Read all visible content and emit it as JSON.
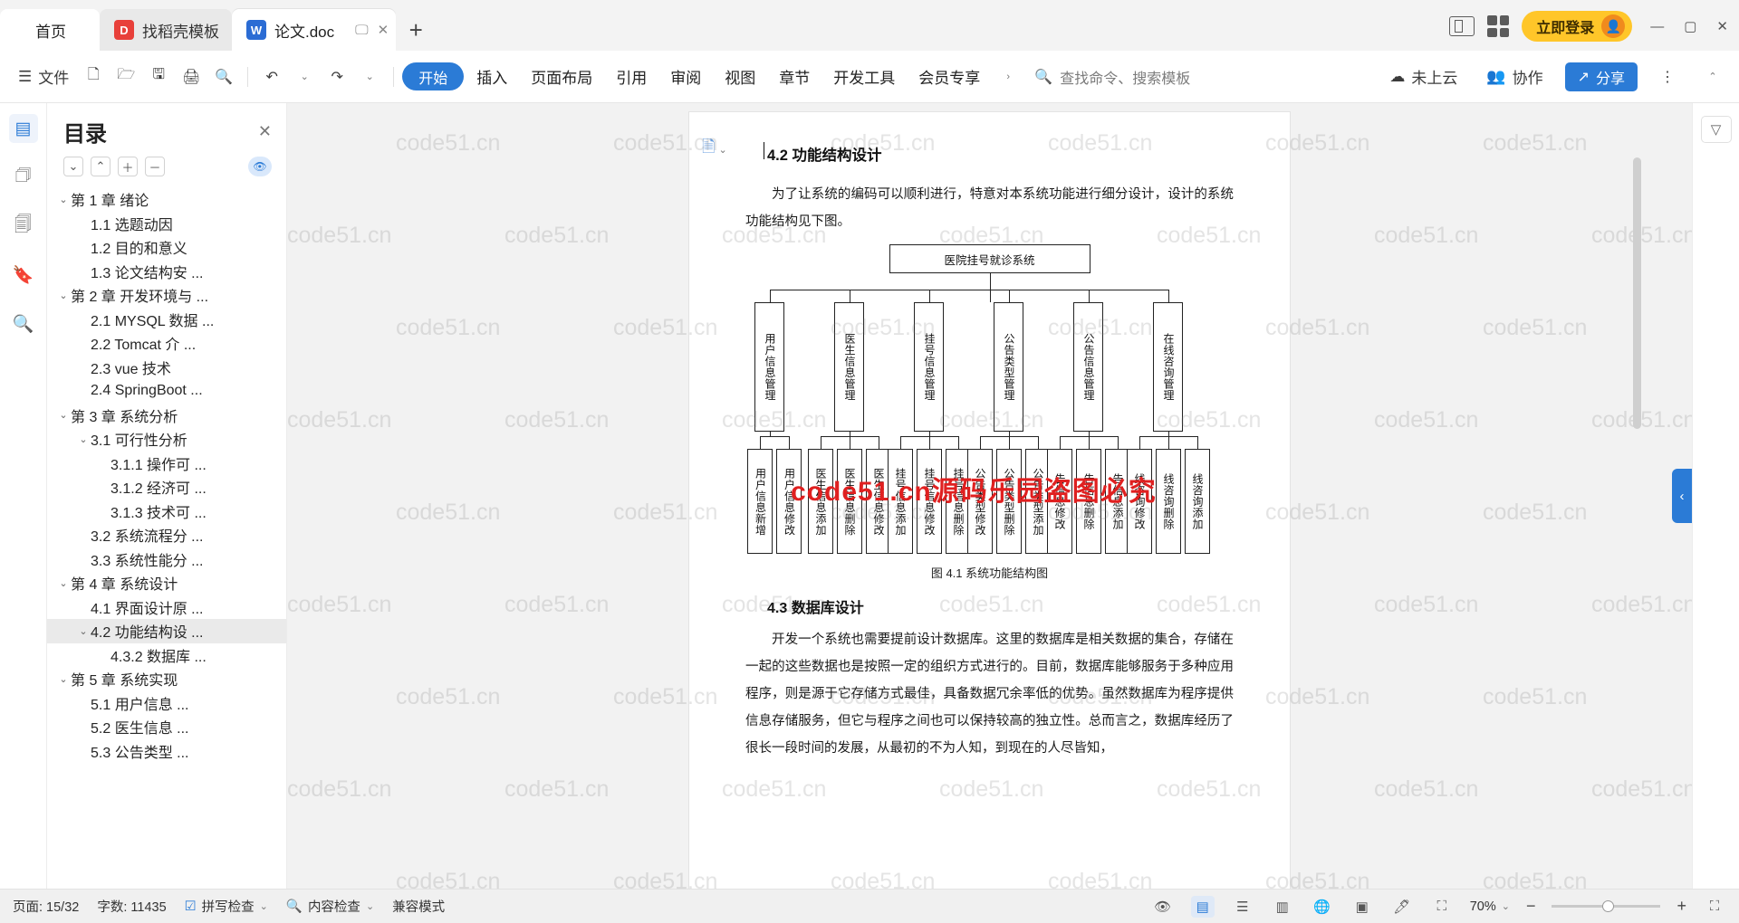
{
  "window": {
    "tabs": [
      {
        "label": "首页",
        "type": "home"
      },
      {
        "label": "找稻壳模板",
        "type": "template",
        "icon": "wps-docer-icon",
        "icon_letter": "D"
      },
      {
        "label": "论文.doc",
        "type": "document",
        "icon": "wps-writer-icon",
        "icon_letter": "W"
      }
    ],
    "new_tab_label": "+",
    "login_label": "立即登录",
    "minimize": "—",
    "maximize": "▢",
    "close": "✕"
  },
  "ribbon": {
    "file_label": "文件",
    "start_label": "开始",
    "menu_items": [
      "插入",
      "页面布局",
      "引用",
      "审阅",
      "视图",
      "章节",
      "开发工具",
      "会员专享"
    ],
    "search_placeholder": "查找命令、搜索模板",
    "cloud_label": "未上云",
    "collab_label": "协作",
    "share_label": "分享",
    "more_label": "⋮"
  },
  "outline": {
    "title": "目录",
    "close_label": "✕",
    "items": [
      {
        "label": "第 1 章  绪论",
        "level": 0,
        "arrow": "⌄",
        "selected": false
      },
      {
        "label": "1.1 选题动因",
        "level": 1,
        "arrow": "",
        "selected": false
      },
      {
        "label": "1.2 目的和意义",
        "level": 1,
        "arrow": "",
        "selected": false
      },
      {
        "label": "1.3 论文结构安 ...",
        "level": 1,
        "arrow": "",
        "selected": false
      },
      {
        "label": "第 2 章  开发环境与 ...",
        "level": 0,
        "arrow": "⌄",
        "selected": false
      },
      {
        "label": "2.1 MYSQL 数据 ...",
        "level": 1,
        "arrow": "",
        "selected": false
      },
      {
        "label": "2.2 Tomcat 介 ...",
        "level": 1,
        "arrow": "",
        "selected": false
      },
      {
        "label": "2.3 vue 技术",
        "level": 1,
        "arrow": "",
        "selected": false
      },
      {
        "label": "2.4 SpringBoot ...",
        "level": 1,
        "arrow": "",
        "selected": false
      },
      {
        "label": "第 3 章  系统分析",
        "level": 0,
        "arrow": "⌄",
        "selected": false
      },
      {
        "label": "3.1 可行性分析",
        "level": 1,
        "arrow": "⌄",
        "selected": false
      },
      {
        "label": "3.1.1 操作可 ...",
        "level": 2,
        "arrow": "",
        "selected": false
      },
      {
        "label": "3.1.2 经济可 ...",
        "level": 2,
        "arrow": "",
        "selected": false
      },
      {
        "label": "3.1.3 技术可 ...",
        "level": 2,
        "arrow": "",
        "selected": false
      },
      {
        "label": "3.2 系统流程分 ...",
        "level": 1,
        "arrow": "",
        "selected": false
      },
      {
        "label": "3.3 系统性能分 ...",
        "level": 1,
        "arrow": "",
        "selected": false
      },
      {
        "label": "第 4 章  系统设计",
        "level": 0,
        "arrow": "⌄",
        "selected": false
      },
      {
        "label": "4.1 界面设计原 ...",
        "level": 1,
        "arrow": "",
        "selected": false
      },
      {
        "label": "4.2 功能结构设 ...",
        "level": 1,
        "arrow": "⌄",
        "selected": true
      },
      {
        "label": "4.3.2  数据库 ...",
        "level": 2,
        "arrow": "",
        "selected": false
      },
      {
        "label": "第 5 章  系统实现",
        "level": 0,
        "arrow": "⌄",
        "selected": false
      },
      {
        "label": "5.1 用户信息 ...",
        "level": 1,
        "arrow": "",
        "selected": false
      },
      {
        "label": "5.2 医生信息 ...",
        "level": 1,
        "arrow": "",
        "selected": false
      },
      {
        "label": "5.3 公告类型 ...",
        "level": 1,
        "arrow": "",
        "selected": false
      }
    ]
  },
  "document": {
    "heading": "4.2 功能结构设计",
    "para1": "为了让系统的编码可以顺利进行，特意对本系统功能进行细分设计，设计的系统功能结构见下图。",
    "figure_caption": "图 4.1  系统功能结构图",
    "heading2": "4.3  数据库设计",
    "para2": "开发一个系统也需要提前设计数据库。这里的数据库是相关数据的集合，存储在一起的这些数据也是按照一定的组织方式进行的。目前，数据库能够服务于多种应用程序，则是源于它存储方式最佳，具备数据冗余率低的优势。虽然数据库为程序提供信息存储服务，但它与程序之间也可以保持较高的独立性。总而言之，数据库经历了很长一段时间的发展，从最初的不为人知，到现在的人尽皆知，",
    "diagram": {
      "root": "医院挂号就诊系统",
      "level2": [
        "用户信息管理",
        "医生信息管理",
        "挂号信息管理",
        "公告类型管理",
        "公告信息管理",
        "在线咨询管理"
      ],
      "level3": [
        "用户信息新增",
        "用户信息修改",
        "医生信息添加",
        "医生信息删除",
        "医生信息修改",
        "挂号信息添加",
        "挂号信息修改",
        "挂号信息删除",
        "公告类型修改",
        "公告类型删除",
        "公告类型添加",
        "告信息修改",
        "告信息删除",
        "告信息添加",
        "线咨询修改",
        "线咨询删除",
        "线咨询添加"
      ]
    }
  },
  "watermark": {
    "text": "code51.cn",
    "red_text": "code51.cn源码乐园盗图必究"
  },
  "status": {
    "page_label": "页面: 15/32",
    "words_label": "字数: 11435",
    "spellcheck_label": "拼写检查",
    "contentcheck_label": "内容检查",
    "compat_label": "兼容模式",
    "zoom_label": "70%",
    "zoom_out": "−",
    "zoom_in": "+",
    "fullscreen": "⛶"
  }
}
